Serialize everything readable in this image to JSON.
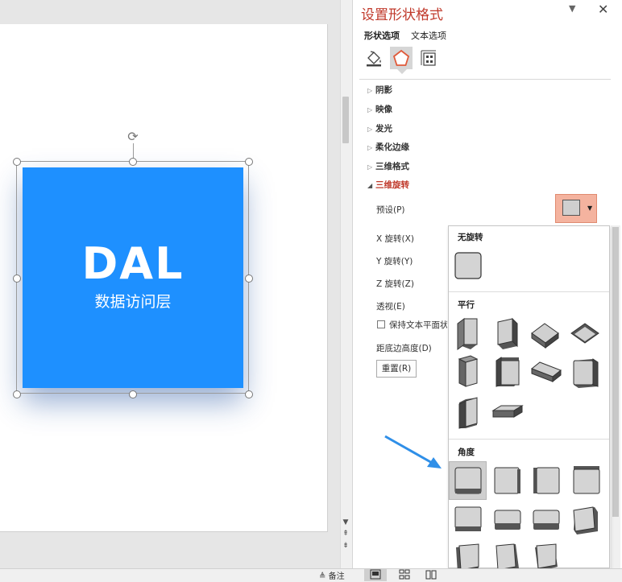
{
  "panel": {
    "title": "设置形状格式",
    "close": "✕",
    "minimize": "▼",
    "tabs": [
      "形状选项",
      "文本选项"
    ],
    "icons": [
      "fill-line-icon",
      "effects-pentagon-icon",
      "size-properties-icon"
    ],
    "sections": {
      "shadow": "阴影",
      "reflection": "映像",
      "glow": "发光",
      "soft_edges": "柔化边缘",
      "format_3d": "三维格式",
      "rotation_3d": "三维旋转"
    },
    "rotation": {
      "preset": "预设(P)",
      "x": "X 旋转(X)",
      "y": "Y 旋转(Y)",
      "z": "Z 旋转(Z)",
      "perspective": "透视(E)",
      "keep_flat": "保持文本平面状",
      "distance": "距底边高度(D)",
      "reset": "重置(R)"
    },
    "gallery": {
      "no_rotation": "无旋转",
      "parallel": "平行",
      "angle": "角度"
    }
  },
  "slide": {
    "title": "DAL",
    "subtitle": "数据访问层",
    "shape_color": "#1e90ff"
  },
  "status": {
    "notes": "备注"
  },
  "colors": {
    "accent_red": "#c0392b",
    "arrow_blue": "#2f8fe8",
    "preset_highlight": "#f4b39f"
  }
}
